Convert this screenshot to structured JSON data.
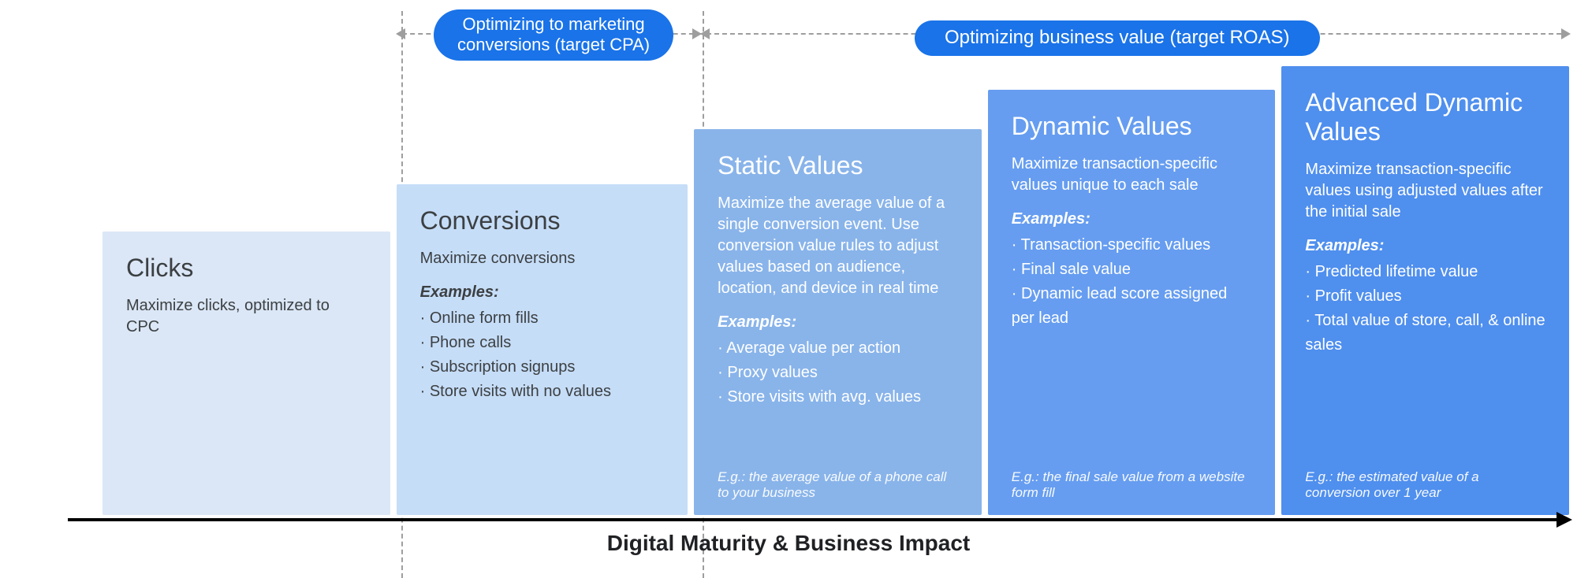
{
  "pills": {
    "cpa": "Optimizing to marketing\nconversions (target CPA)",
    "roas": "Optimizing business value (target ROAS)"
  },
  "axis_label": "Digital Maturity & Business Impact",
  "bars": [
    {
      "title": "Clicks",
      "subtitle": "Maximize clicks, optimized to CPC",
      "examples_header": "",
      "examples": [],
      "footnote": ""
    },
    {
      "title": "Conversions",
      "subtitle": "Maximize conversions",
      "examples_header": "Examples:",
      "examples": [
        "Online form fills",
        "Phone calls",
        "Subscription signups",
        "Store visits with no values"
      ],
      "footnote": ""
    },
    {
      "title": "Static Values",
      "subtitle": "Maximize the average value of a single conversion event. Use conversion value rules to adjust values based on audience, location, and device in real time",
      "examples_header": "Examples:",
      "examples": [
        "Average value per action",
        "Proxy values",
        "Store visits with avg. values"
      ],
      "footnote": "E.g.: the average value of a phone call to your business"
    },
    {
      "title": "Dynamic Values",
      "subtitle": "Maximize transaction-specific values unique to each sale",
      "examples_header": "Examples:",
      "examples": [
        "Transaction-specific values",
        "Final sale value",
        "Dynamic lead score assigned per lead"
      ],
      "footnote": "E.g.: the final sale value from a website form fill"
    },
    {
      "title": "Advanced Dynamic Values",
      "subtitle": "Maximize transaction-specific values using adjusted values after the initial sale",
      "examples_header": "Examples:",
      "examples": [
        "Predicted lifetime value",
        "Profit values",
        "Total value of store, call, & online sales"
      ],
      "footnote": "E.g.: the estimated value of a conversion over 1 year"
    }
  ],
  "chart_data": {
    "type": "bar",
    "title": "Digital Maturity & Business Impact",
    "xlabel": "Digital Maturity & Business Impact",
    "ylabel": "",
    "categories": [
      "Clicks",
      "Conversions",
      "Static Values",
      "Dynamic Values",
      "Advanced Dynamic Values"
    ],
    "values": [
      1,
      2,
      3,
      4,
      5
    ],
    "groups": [
      {
        "label": "Optimizing to marketing conversions (target CPA)",
        "members": [
          "Conversions"
        ]
      },
      {
        "label": "Optimizing business value (target ROAS)",
        "members": [
          "Static Values",
          "Dynamic Values",
          "Advanced Dynamic Values"
        ]
      }
    ],
    "ylim": [
      0,
      5
    ]
  }
}
